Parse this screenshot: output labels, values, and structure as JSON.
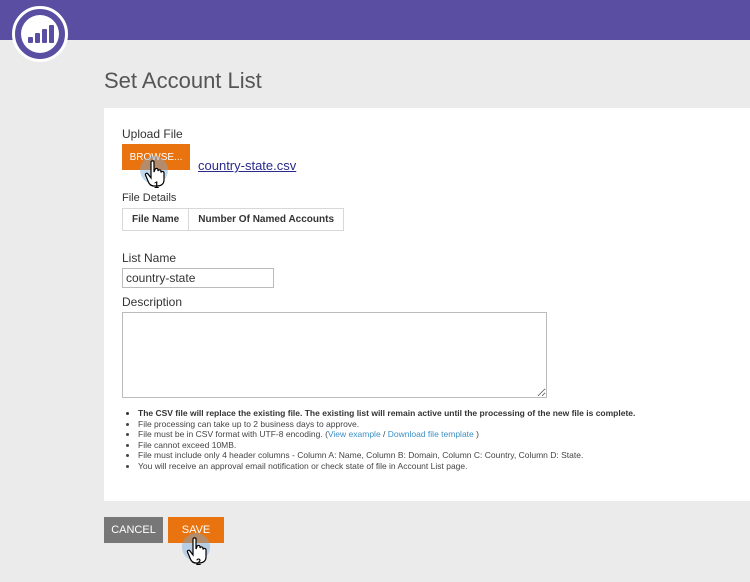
{
  "page": {
    "title": "Set Account List"
  },
  "upload": {
    "label": "Upload File",
    "browse_label": "BROWSE...",
    "file_name": "country-state.csv"
  },
  "file_details": {
    "label": "File Details",
    "columns": [
      "File Name",
      "Number Of Named Accounts"
    ]
  },
  "list_name": {
    "label": "List Name",
    "value": "country-state"
  },
  "description": {
    "label": "Description",
    "value": ""
  },
  "notes": {
    "item1": "The CSV file will replace the existing file. The existing list will remain active until the processing of the new file is complete.",
    "item2": "File processing can take up to 2 business days to approve.",
    "item3_prefix": "File must be in CSV format with UTF-8 encoding. (",
    "item3_link1": "View example",
    "item3_sep": " / ",
    "item3_link2": "Download file template",
    "item3_suffix": " )",
    "item4": "File cannot exceed 10MB.",
    "item5": "File must include only 4 header columns - Column A: Name, Column B: Domain, Column C: Country, Column D: State.",
    "item6": "You will receive an approval email notification or check state of file in Account List page."
  },
  "actions": {
    "cancel_label": "CANCEL",
    "save_label": "SAVE"
  },
  "cursors": {
    "step1": "1",
    "step2": "2"
  },
  "colors": {
    "brand": "#5a4ea3",
    "accent": "#e8730f",
    "cancel": "#777777",
    "link": "#3b8fc4"
  }
}
